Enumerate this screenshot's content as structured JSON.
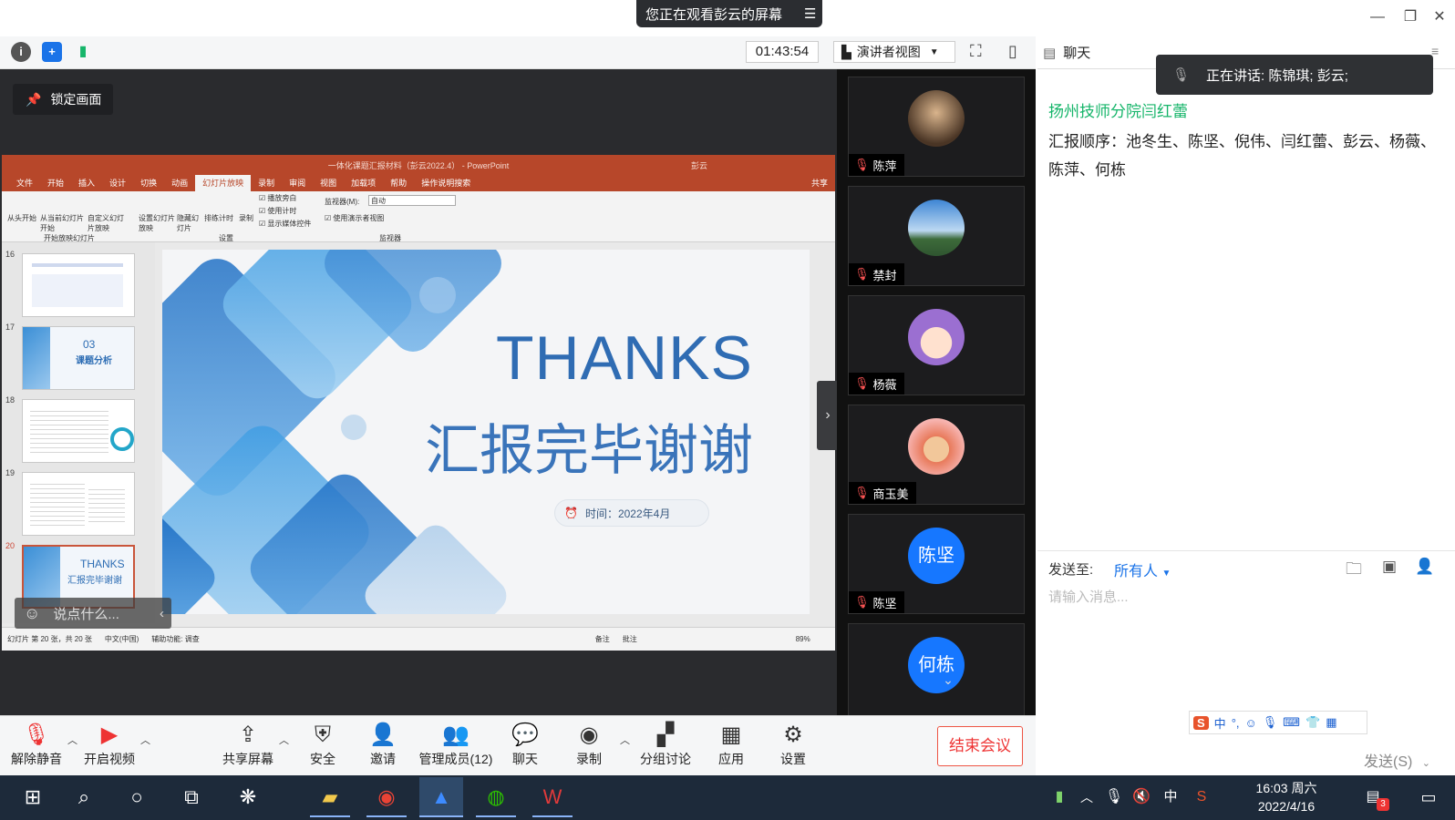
{
  "window": {
    "share_banner": "您正在观看彭云的屏幕"
  },
  "topbar": {
    "timer": "01:43:54",
    "view_mode": "演讲者视图",
    "chat_label": "聊天"
  },
  "speaking": {
    "text": "正在讲话: 陈锦琪; 彭云;"
  },
  "stage": {
    "lock_label": "锁定画面",
    "comment_placeholder": "说点什么..."
  },
  "ppt": {
    "title": "一体化课题汇报材料（彭云2022.4） - PowerPoint",
    "user": "彭云",
    "share": "共享",
    "tabs": [
      "文件",
      "开始",
      "插入",
      "设计",
      "切换",
      "动画",
      "幻灯片放映",
      "录制",
      "审阅",
      "视图",
      "加载项",
      "帮助",
      "操作说明搜索"
    ],
    "active_tab": "幻灯片放映",
    "ribbon": {
      "start_first": "从头开始",
      "start_current": "从当前幻灯片开始",
      "custom": "自定义幻灯片放映",
      "group1": "开始放映幻灯片",
      "setup": "设置幻灯片放映",
      "hide": "隐藏幻灯片",
      "rehearse": "排练计时",
      "record": "录制",
      "cb_narration": "播放旁白",
      "cb_timing": "使用计时",
      "cb_controls": "显示媒体控件",
      "group2": "设置",
      "monitor_lbl": "监视器(M):",
      "monitor_val": "自动",
      "cb_presenter": "使用演示者视图",
      "group3": "监视器"
    },
    "thumbs": [
      {
        "num": "16",
        "text": ""
      },
      {
        "num": "17",
        "text": "03\n课题分析"
      },
      {
        "num": "18",
        "text": ""
      },
      {
        "num": "19",
        "text": ""
      },
      {
        "num": "20",
        "text": "THANKS\n汇报完毕谢谢"
      }
    ],
    "thumb17_a": "03",
    "thumb17_b": "课题分析",
    "thumb20_a": "THANKS",
    "thumb20_b": "汇报完毕谢谢",
    "slide": {
      "title": "THANKS",
      "subtitle": "汇报完毕谢谢",
      "time": "时间：2022年4月"
    },
    "status": {
      "page": "幻灯片 第 20 张，共 20 张",
      "lang": "中文(中国)",
      "access": "辅助功能: 调查",
      "notes": "备注",
      "comments": "批注",
      "zoom": "89%"
    }
  },
  "participants": [
    {
      "name": "陈萍",
      "avatar": "photo",
      "color": "#7a5b3e"
    },
    {
      "name": "禁封",
      "avatar": "photo",
      "color": "#4a7fb8"
    },
    {
      "name": "杨薇",
      "avatar": "cartoon",
      "color": "#9b6fd1"
    },
    {
      "name": "商玉美",
      "avatar": "cartoon",
      "color": "#e8795a"
    },
    {
      "name": "陈坚",
      "avatar": "陈坚",
      "color": "#1677ff"
    },
    {
      "name": "何栋",
      "avatar": "何栋",
      "color": "#1677ff"
    }
  ],
  "chat": {
    "sender": "扬州技师分院闫红蕾",
    "message": "汇报顺序：池冬生、陈坚、倪伟、闫红蕾、彭云、杨薇、陈萍、何栋",
    "send_to_label": "发送至:",
    "send_to_value": "所有人",
    "placeholder": "请输入消息...",
    "send_button": "发送(S)",
    "ime_lang": "中"
  },
  "toolbar": {
    "unmute": "解除静音",
    "video": "开启视频",
    "share": "共享屏幕",
    "security": "安全",
    "invite": "邀请",
    "members": "管理成员(12)",
    "chat": "聊天",
    "record": "录制",
    "breakout": "分组讨论",
    "apps": "应用",
    "settings": "设置",
    "end": "结束会议"
  },
  "taskbar": {
    "time": "16:03 周六",
    "date": "2022/4/16",
    "ime": "中",
    "badge": "3"
  }
}
